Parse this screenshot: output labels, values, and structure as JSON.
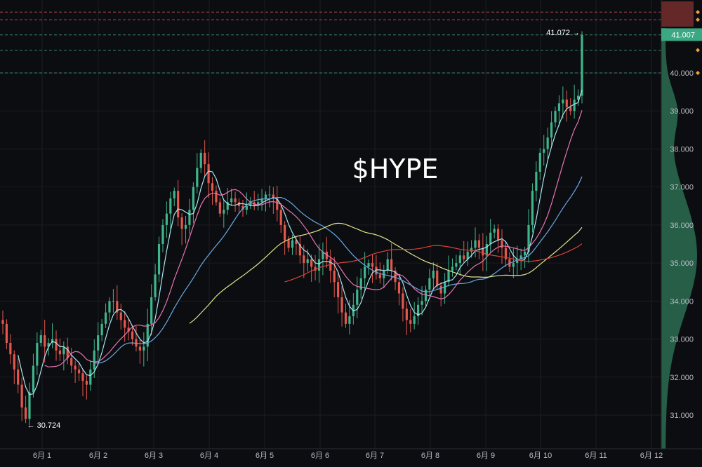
{
  "chart_data": {
    "type": "candlestick",
    "title": "$HYPE",
    "x_ticks": [
      "6月 1",
      "6月 2",
      "6月 3",
      "6月 4",
      "6月 5",
      "6月 6",
      "6月 7",
      "6月 8",
      "6月 9",
      "6月 10",
      "6月 11",
      "6月 12"
    ],
    "y_ticks": [
      "31.000",
      "32.000",
      "33.000",
      "34.000",
      "35.000",
      "36.000",
      "37.000",
      "38.000",
      "39.000",
      "40.000"
    ],
    "ylim": [
      30.0,
      42.0
    ],
    "grid": true,
    "last_price": "41.007",
    "high_label": "41.072",
    "low_label": "30.724",
    "horizontal_levels": [
      {
        "value": 41.6,
        "color": "#e05a5a"
      },
      {
        "value": 41.4,
        "color": "#e05a5a"
      },
      {
        "value": 41.0,
        "color": "#3aa883"
      },
      {
        "value": 40.6,
        "color": "#3aa883"
      },
      {
        "value": 40.0,
        "color": "#3aa883"
      }
    ],
    "closes": [
      33.4,
      32.9,
      32.6,
      32.2,
      31.8,
      31.2,
      30.9,
      31.6,
      32.3,
      32.9,
      33.1,
      32.8,
      32.9,
      33.0,
      32.7,
      32.6,
      32.8,
      32.5,
      32.3,
      32.2,
      32.1,
      31.9,
      31.8,
      32.2,
      32.7,
      33.1,
      33.4,
      33.7,
      34.0,
      34.0,
      33.7,
      33.5,
      33.3,
      33.2,
      33.0,
      32.8,
      32.7,
      32.8,
      33.4,
      34.1,
      34.7,
      35.5,
      36.0,
      36.3,
      36.7,
      36.9,
      36.2,
      35.9,
      36.0,
      36.4,
      37.0,
      37.5,
      37.9,
      37.6,
      37.1,
      36.9,
      36.6,
      36.3,
      36.4,
      36.6,
      36.7,
      36.6,
      36.5,
      36.4,
      36.5,
      36.6,
      36.5,
      36.6,
      36.7,
      36.8,
      36.8,
      36.7,
      36.4,
      36.0,
      35.6,
      35.4,
      35.6,
      35.5,
      35.2,
      35.0,
      35.1,
      34.9,
      34.8,
      35.1,
      35.3,
      35.1,
      34.8,
      34.5,
      34.1,
      33.7,
      33.4,
      33.6,
      33.9,
      34.3,
      34.6,
      34.9,
      35.0,
      34.9,
      34.7,
      34.6,
      34.8,
      35.1,
      34.8,
      34.5,
      34.2,
      33.8,
      33.5,
      33.4,
      33.6,
      33.9,
      34.0,
      34.3,
      34.6,
      34.8,
      34.4,
      34.2,
      34.5,
      34.8,
      34.9,
      35.0,
      35.2,
      35.1,
      35.3,
      35.4,
      35.6,
      35.4,
      35.2,
      35.5,
      35.8,
      35.9,
      35.6,
      35.4,
      35.1,
      34.9,
      35.0,
      35.1,
      35.2,
      35.3,
      36.0,
      36.9,
      37.4,
      37.9,
      38.0,
      38.3,
      38.7,
      39.0,
      39.2,
      39.3,
      39.1,
      39.0,
      39.3,
      39.4,
      41.0
    ],
    "ma_lines": [
      {
        "name": "MA-short",
        "color": "#a8e7f5",
        "period": 5
      },
      {
        "name": "MA-mid",
        "color": "#e874b4",
        "period": 12
      },
      {
        "name": "MA-long",
        "color": "#6aa9e8",
        "period": 25
      },
      {
        "name": "MA-xlong",
        "color": "#e2e38d",
        "period": 50
      },
      {
        "name": "MA-max",
        "color": "#d8433c",
        "period": 75
      }
    ],
    "volume_profile_colors": {
      "up": "#2f7a5a",
      "down": "#7a3030"
    }
  }
}
